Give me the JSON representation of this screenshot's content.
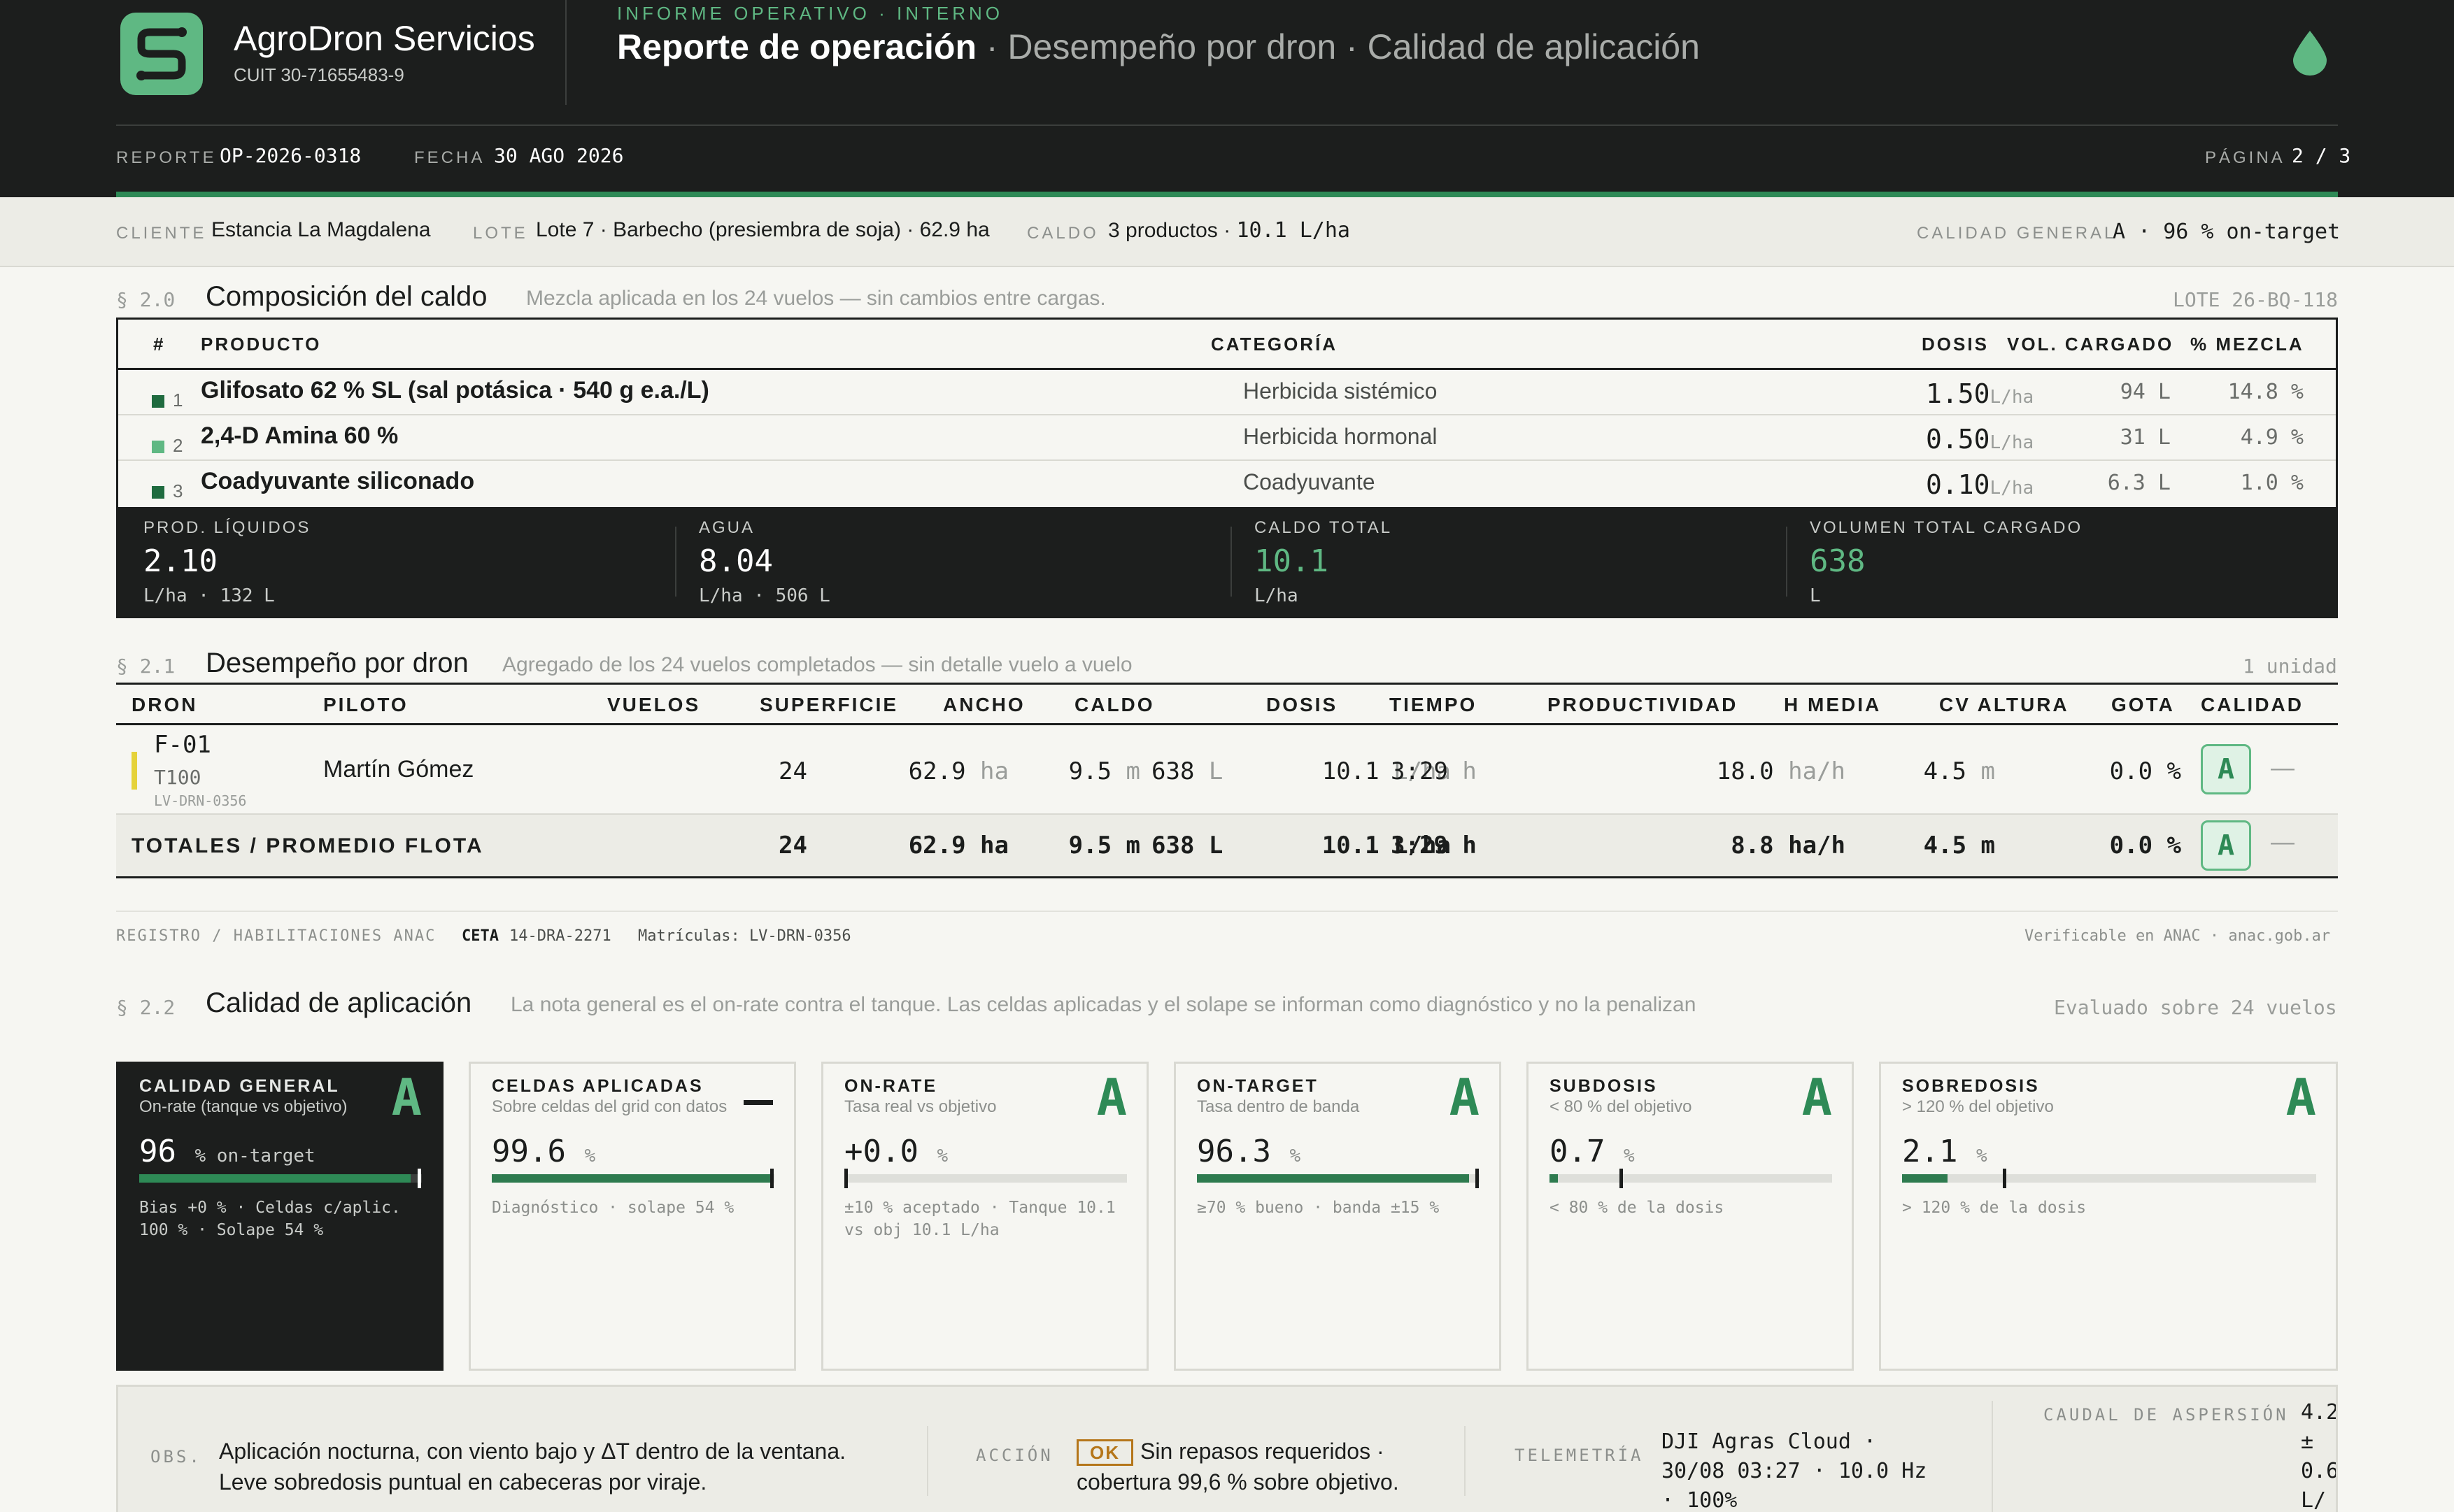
{
  "header": {
    "company_name": "AgroDron Servicios",
    "company_cuit": "CUIT 30-71655483-9",
    "eyebrow": "INFORME OPERATIVO · INTERNO",
    "title_main": "Reporte de operación",
    "title_rest": " · Desempeño por dron · Calidad de aplicación",
    "report_label": "REPORTE",
    "report_value": "OP-2026-0318",
    "date_label": "FECHA",
    "date_value": "30 AGO 2026",
    "page_label": "PÁGINA",
    "page_value": "2 / 3",
    "logo_icon": "agrodron-logo",
    "drop_icon": "water-drop-icon"
  },
  "context": {
    "client_label": "CLIENTE",
    "client_value": "Estancia La Magdalena",
    "lot_label": "LOTE",
    "lot_value": "Lote 7 · Barbecho (presiembra de soja) · 62.9 ha",
    "mix_label": "CALDO",
    "mix_value_a": "3 productos · ",
    "mix_value_b": "10.1 L/ha",
    "quality_label": "CALIDAD GENERAL",
    "quality_value": "A · 96 % on-target"
  },
  "composition": {
    "section_no": "§ 2.0",
    "title": "Composición del caldo",
    "subtitle": "Mezcla aplicada en los 24 vuelos — sin cambios entre cargas.",
    "batch": "LOTE 26-BQ-118",
    "headers": {
      "num": "#",
      "product": "PRODUCTO",
      "category": "CATEGORÍA",
      "dose": "DOSIS",
      "volume": "VOL. CARGADO",
      "mix_pct": "% MEZCLA"
    },
    "rows": [
      {
        "num": "1",
        "product": "Glifosato 62 % SL (sal potásica · 540 g e.a./L)",
        "category": "Herbicida sistémico",
        "dose": "1.50",
        "dose_unit": "L/ha",
        "volume": "94 L",
        "mix_pct": "14.8 %",
        "color": "#1f6b3f"
      },
      {
        "num": "2",
        "product": "2,4-D Amina 60 %",
        "category": "Herbicida hormonal",
        "dose": "0.50",
        "dose_unit": "L/ha",
        "volume": "31 L",
        "mix_pct": "4.9 %",
        "color": "#5fb883"
      },
      {
        "num": "3",
        "product": "Coadyuvante siliconado",
        "category": "Coadyuvante",
        "dose": "0.10",
        "dose_unit": "L/ha",
        "volume": "6.3 L",
        "mix_pct": "1.0 %",
        "color": "#1f6b3f"
      }
    ],
    "summary": [
      {
        "label": "PROD. LÍQUIDOS",
        "value": "2.10",
        "unit": "L/ha · 132 L",
        "accent": false
      },
      {
        "label": "AGUA",
        "value": "8.04",
        "unit": "L/ha · 506 L",
        "accent": false
      },
      {
        "label": "CALDO TOTAL",
        "value": "10.1",
        "unit": "L/ha",
        "accent": true
      },
      {
        "label": "VOLUMEN TOTAL CARGADO",
        "value": "638",
        "unit": "L",
        "accent": true
      }
    ]
  },
  "drones": {
    "section_no": "§ 2.1",
    "title": "Desempeño por dron",
    "subtitle": "Agregado de los 24 vuelos completados — sin detalle vuelo a vuelo",
    "count": "1 unidad",
    "headers": [
      "DRON",
      "PILOTO",
      "VUELOS",
      "SUPERFICIE",
      "ANCHO",
      "CALDO",
      "DOSIS",
      "TIEMPO",
      "PRODUCTIVIDAD",
      "H MEDIA",
      "CV ALTURA",
      "GOTA",
      "CALIDAD"
    ],
    "row": {
      "drone_id": "F-01",
      "model": "T100",
      "registration": "LV-DRN-0356",
      "pilot": "Martín Gómez",
      "flights": "24",
      "area": "62.9",
      "area_u": "ha",
      "width": "9.5",
      "width_u": "m",
      "volume": "638",
      "volume_u": "L",
      "dose": "10.1",
      "dose_u": "L/ha",
      "time": "3:29",
      "time_u": "h",
      "productivity": "18.0",
      "productivity_u": "ha/h",
      "height": "4.5",
      "height_u": "m",
      "cv": "0.0 %",
      "droplet": "—",
      "grade": "A"
    },
    "totals": {
      "label": "TOTALES / PROMEDIO FLOTA",
      "flights": "24",
      "area": "62.9 ha",
      "width": "9.5 m",
      "volume": "638 L",
      "dose": "10.1 L/ha",
      "time": "3:29 h",
      "productivity": "8.8 ha/h",
      "height": "4.5 m",
      "cv": "0.0 %",
      "droplet": "—",
      "grade": "A"
    },
    "registry_label": "REGISTRO / HABILITACIONES ANAC",
    "ceta_label": "CETA",
    "ceta_value": "14-DRA-2271",
    "plates": "Matrículas: LV-DRN-0356",
    "verify": "Verificable en ANAC · anac.gob.ar"
  },
  "quality": {
    "section_no": "§ 2.2",
    "title": "Calidad de aplicación",
    "subtitle": "La nota general es el on-rate contra el tanque. Las celdas aplicadas y el solape se informan como diagnóstico y no la penalizan",
    "evaluated": "Evaluado sobre 24 vuelos",
    "cards": [
      {
        "title": "CALIDAD GENERAL",
        "sub": "On-rate (tanque vs objetivo)",
        "grade": "A",
        "value": "96",
        "unit": "% on-target",
        "note1": "Bias +0 % · Celdas c/aplic.",
        "note2": "100 % · Solape 54 %",
        "fill": 0.96
      },
      {
        "title": "CELDAS APLICADAS",
        "sub": "Sobre celdas del grid con datos",
        "grade": "",
        "value": "99.6",
        "unit": "%",
        "note1": "Diagnóstico · solape 54 %",
        "note2": "",
        "fill": 0.996
      },
      {
        "title": "ON-RATE",
        "sub": "Tasa real vs objetivo",
        "grade": "A",
        "value": "+0.0",
        "unit": "%",
        "note1": "±10 % aceptado · Tanque 10.1",
        "note2": "vs obj 10.1 L/ha",
        "fill": 0.0
      },
      {
        "title": "ON-TARGET",
        "sub": "Tasa dentro de banda",
        "grade": "A",
        "value": "96.3",
        "unit": "%",
        "note1": "≥70 % bueno · banda ±15 %",
        "note2": "",
        "fill": 0.963
      },
      {
        "title": "SUBDOSIS",
        "sub": "< 80 % del objetivo",
        "grade": "A",
        "value": "0.7",
        "unit": "%",
        "note1": "< 80 % de la dosis",
        "note2": "",
        "fill": 0.03
      },
      {
        "title": "SOBREDOSIS",
        "sub": "> 120 % del objetivo",
        "grade": "A",
        "value": "2.1",
        "unit": "%",
        "note1": "> 120 % de la dosis",
        "note2": "",
        "fill": 0.11
      }
    ]
  },
  "footer": {
    "obs_label": "OBS.",
    "obs_text": "Aplicación nocturna, con viento bajo y ΔT dentro de la ventana. Leve sobredosis puntual en cabeceras por viraje.",
    "action_label": "ACCIÓN",
    "action_badge": "OK",
    "action_text": "Sin repasos requeridos · cobertura 99,6 % sobre objetivo.",
    "telemetry_label": "TELEMETRÍA",
    "telemetry_text": "DJI Agras Cloud · 30/08 03:27 · 10.0 Hz · 100%",
    "flow_label": "CAUDAL DE ASPERSIÓN",
    "flow_text": "4.2 ± 0.6 L/"
  }
}
